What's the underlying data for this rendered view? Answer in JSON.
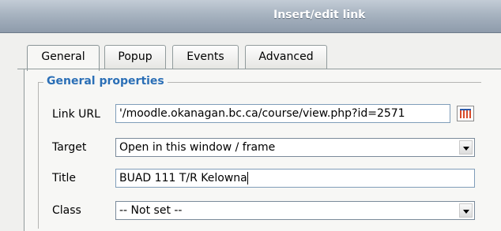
{
  "window": {
    "title": "Insert/edit link"
  },
  "tabs": [
    {
      "label": "General",
      "active": true
    },
    {
      "label": "Popup",
      "active": false
    },
    {
      "label": "Events",
      "active": false
    },
    {
      "label": "Advanced",
      "active": false
    }
  ],
  "section": {
    "legend": "General properties"
  },
  "fields": {
    "link_url": {
      "label": "Link URL",
      "value": "'/moodle.okanagan.bc.ca/course/view.php?id=2571"
    },
    "target": {
      "label": "Target",
      "value": "Open in this window / frame"
    },
    "title": {
      "label": "Title",
      "value": "BUAD 111 T/R Kelowna"
    },
    "class": {
      "label": "Class",
      "value": "-- Not set --"
    }
  },
  "icons": {
    "browse": "browse-list-icon",
    "dropdown": "chevron-down-icon"
  },
  "colors": {
    "legend": "#2b6fb6",
    "titlebar": "#a7b3c0"
  }
}
